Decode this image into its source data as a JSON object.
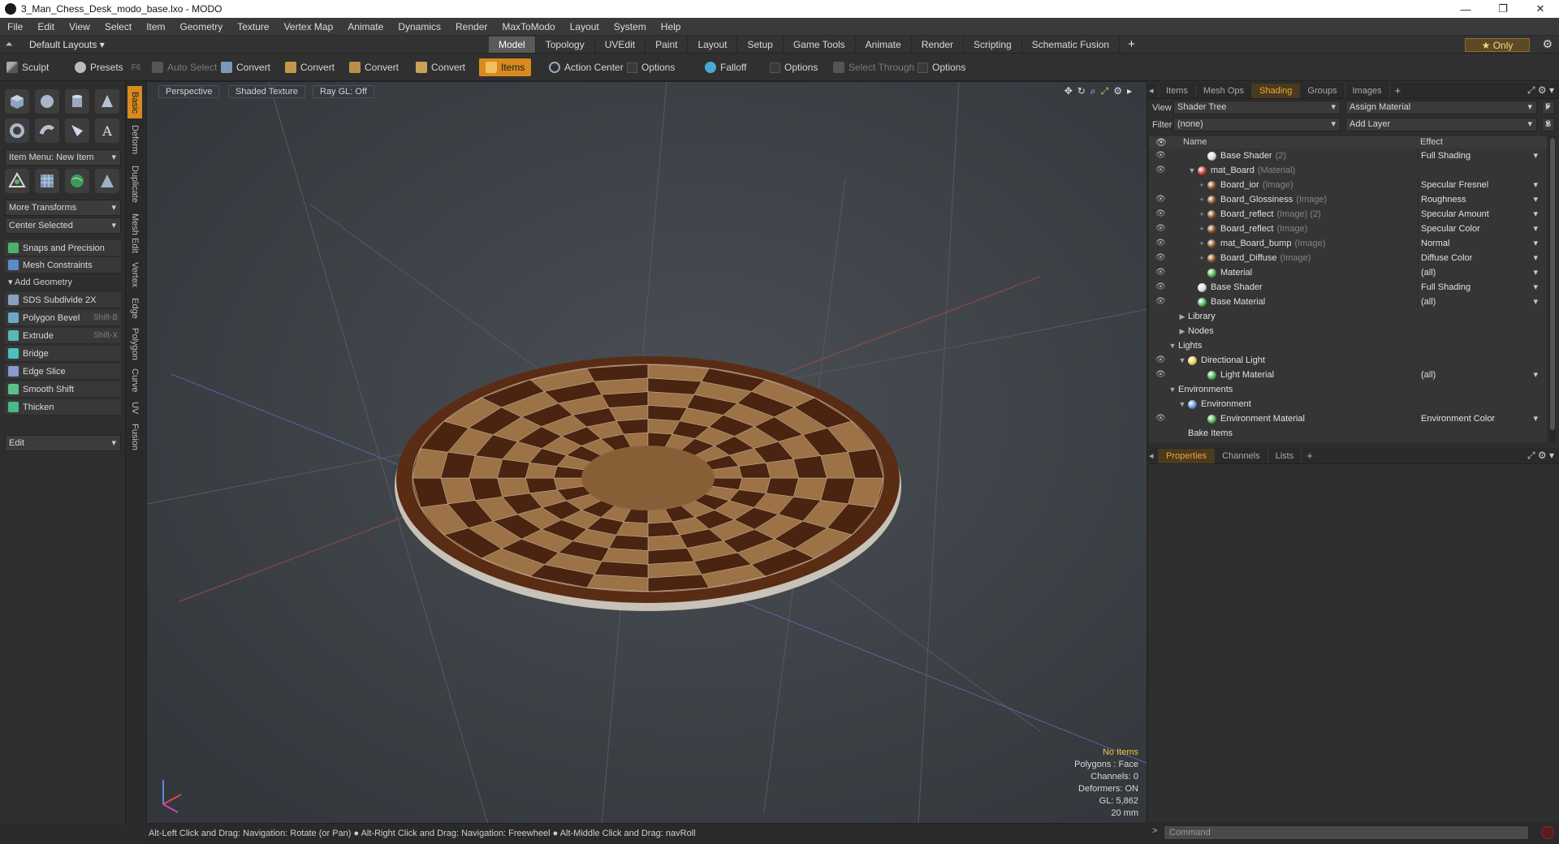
{
  "window": {
    "title": "3_Man_Chess_Desk_modo_base.lxo - MODO",
    "minimize": "—",
    "maximize": "❐",
    "close": "✕"
  },
  "menu": [
    "File",
    "Edit",
    "View",
    "Select",
    "Item",
    "Geometry",
    "Texture",
    "Vertex Map",
    "Animate",
    "Dynamics",
    "Render",
    "MaxToModo",
    "Layout",
    "System",
    "Help"
  ],
  "layouts": {
    "dropdown": "Default Layouts",
    "tabs": [
      "Model",
      "Topology",
      "UVEdit",
      "Paint",
      "Layout",
      "Setup",
      "Game Tools",
      "Animate",
      "Render",
      "Scripting",
      "Schematic Fusion"
    ],
    "active_tab": "Model",
    "plus": "+",
    "only": "★  Only"
  },
  "toolbar": {
    "sculpt": "Sculpt",
    "presets": "Presets",
    "presets_key": "F6",
    "auto_select": "Auto Select",
    "convert1": "Convert",
    "convert2": "Convert",
    "convert3": "Convert",
    "convert4": "Convert",
    "items": "Items",
    "action_center": "Action Center",
    "options1": "Options",
    "falloff": "Falloff",
    "options2": "Options",
    "select_through": "Select Through",
    "options3": "Options"
  },
  "left_panel": {
    "item_menu": "Item Menu: New Item",
    "more_transforms": "More Transforms",
    "center_selected": "Center Selected",
    "snaps": "Snaps and Precision",
    "mesh_constraints": "Mesh Constraints",
    "add_geometry": "Add Geometry",
    "tools": [
      {
        "label": "SDS Subdivide 2X",
        "key": ""
      },
      {
        "label": "Polygon Bevel",
        "key": "Shift-B"
      },
      {
        "label": "Extrude",
        "key": "Shift-X"
      },
      {
        "label": "Bridge",
        "key": ""
      },
      {
        "label": "Edge Slice",
        "key": ""
      },
      {
        "label": "Smooth Shift",
        "key": ""
      },
      {
        "label": "Thicken",
        "key": ""
      }
    ],
    "edit_dropdown": "Edit",
    "vtabs": [
      "Basic",
      "Deform",
      "Duplicate",
      "Mesh Edit",
      "Vertex",
      "Edge",
      "Polygon",
      "Curve",
      "UV",
      "Fusion"
    ]
  },
  "viewport": {
    "perspective": "Perspective",
    "shading": "Shaded Texture",
    "raygl": "Ray GL: Off",
    "info": {
      "no_items": "No Items",
      "polygons": "Polygons : Face",
      "channels": "Channels: 0",
      "deformers": "Deformers: ON",
      "gl": "GL: 5,862",
      "scale": "20 mm"
    }
  },
  "status": "Alt-Left Click and Drag: Navigation: Rotate (or Pan) ● Alt-Right Click and Drag: Navigation: Freewheel ● Alt-Middle Click and Drag: navRoll",
  "right_panel": {
    "tabs": [
      "Items",
      "Mesh Ops",
      "Shading",
      "Groups",
      "Images"
    ],
    "active_tab": "Shading",
    "plus": "+",
    "view_label": "View",
    "view_value": "Shader Tree",
    "assign_material": "Assign Material",
    "f_btn": "F",
    "filter_label": "Filter",
    "filter_value": "(none)",
    "add_layer": "Add Layer",
    "s_btn": "S",
    "col_name": "Name",
    "col_effect": "Effect",
    "rows": [
      {
        "name": "Base Shader",
        "sub": "(2)",
        "effect": "Full Shading",
        "ball": "#d8d8d8",
        "indent": 60,
        "eye": true,
        "exp": "",
        "dd": true
      },
      {
        "name": "mat_Board",
        "sub": "(Material)",
        "effect": "",
        "ball": "#c0392b",
        "indent": 48,
        "eye": true,
        "exp": "▼",
        "dd": false
      },
      {
        "name": "Board_ior",
        "sub": "(Image)",
        "effect": "Specular Fresnel",
        "ball": "#7a4a1e",
        "indent": 60,
        "eye": false,
        "exp": "+",
        "dd": true
      },
      {
        "name": "Board_Glossiness",
        "sub": "(Image)",
        "effect": "Roughness",
        "ball": "#7a4a1e",
        "indent": 60,
        "eye": true,
        "exp": "+",
        "dd": true
      },
      {
        "name": "Board_reflect",
        "sub": "(Image) (2)",
        "effect": "Specular Amount",
        "ball": "#7a4a1e",
        "indent": 60,
        "eye": true,
        "exp": "+",
        "dd": true
      },
      {
        "name": "Board_reflect",
        "sub": "(Image)",
        "effect": "Specular Color",
        "ball": "#7a4a1e",
        "indent": 60,
        "eye": true,
        "exp": "+",
        "dd": true
      },
      {
        "name": "mat_Board_bump",
        "sub": "(Image)",
        "effect": "Normal",
        "ball": "#7a4a1e",
        "indent": 60,
        "eye": true,
        "exp": "+",
        "dd": true
      },
      {
        "name": "Board_Diffuse",
        "sub": "(Image)",
        "effect": "Diffuse Color",
        "ball": "#7a4a1e",
        "indent": 60,
        "eye": true,
        "exp": "+",
        "dd": true
      },
      {
        "name": "Material",
        "sub": "",
        "effect": "(all)",
        "ball": "#4caf50",
        "indent": 60,
        "eye": true,
        "exp": "",
        "dd": true
      },
      {
        "name": "Base Shader",
        "sub": "",
        "effect": "Full Shading",
        "ball": "#d8d8d8",
        "indent": 48,
        "eye": true,
        "exp": "",
        "dd": true
      },
      {
        "name": "Base Material",
        "sub": "",
        "effect": "(all)",
        "ball": "#4caf50",
        "indent": 48,
        "eye": true,
        "exp": "",
        "dd": true
      },
      {
        "name": "Library",
        "sub": "",
        "effect": "",
        "ball": "",
        "indent": 36,
        "eye": false,
        "exp": "▶",
        "dd": false
      },
      {
        "name": "Nodes",
        "sub": "",
        "effect": "",
        "ball": "",
        "indent": 36,
        "eye": false,
        "exp": "▶",
        "dd": false
      },
      {
        "name": "Lights",
        "sub": "",
        "effect": "",
        "ball": "",
        "indent": 24,
        "eye": false,
        "exp": "▼",
        "dd": false
      },
      {
        "name": "Directional Light",
        "sub": "",
        "effect": "",
        "ball": "#e6d14a",
        "indent": 36,
        "eye": true,
        "exp": "▼",
        "dd": false
      },
      {
        "name": "Light Material",
        "sub": "",
        "effect": "(all)",
        "ball": "#4caf50",
        "indent": 60,
        "eye": true,
        "exp": "",
        "dd": true
      },
      {
        "name": "Environments",
        "sub": "",
        "effect": "",
        "ball": "",
        "indent": 24,
        "eye": false,
        "exp": "▼",
        "dd": false
      },
      {
        "name": "Environment",
        "sub": "",
        "effect": "",
        "ball": "#5b8fd6",
        "indent": 36,
        "eye": false,
        "exp": "▼",
        "dd": false
      },
      {
        "name": "Environment Material",
        "sub": "",
        "effect": "Environment Color",
        "ball": "#4caf50",
        "indent": 60,
        "eye": true,
        "exp": "",
        "dd": true
      },
      {
        "name": "Bake Items",
        "sub": "",
        "effect": "",
        "ball": "",
        "indent": 36,
        "eye": false,
        "exp": "",
        "dd": false
      }
    ],
    "prop_tabs": [
      "Properties",
      "Channels",
      "Lists"
    ],
    "prop_active": "Properties",
    "command_placeholder": "Command"
  },
  "colors": {
    "accent": "#d88a1e",
    "viewport_bg": "#3c4045",
    "board_dark": "#4a2410",
    "board_light": "#9c7246"
  }
}
